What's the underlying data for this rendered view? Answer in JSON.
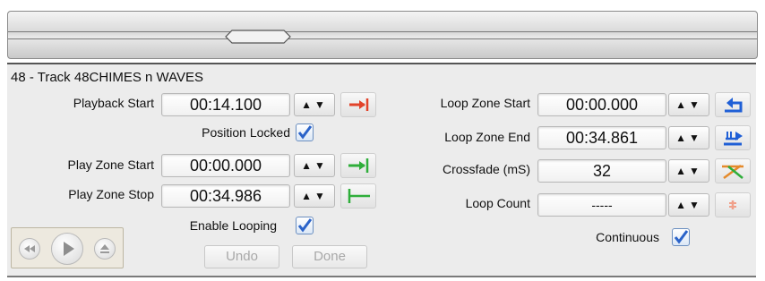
{
  "track_title": "48 - Track 48CHIMES n WAVES",
  "left": {
    "playback_start": {
      "label": "Playback Start",
      "value": "00:14.100"
    },
    "position_locked": {
      "label": "Position Locked",
      "checked": true
    },
    "play_zone_start": {
      "label": "Play Zone Start",
      "value": "00:00.000"
    },
    "play_zone_stop": {
      "label": "Play Zone Stop",
      "value": "00:34.986"
    },
    "enable_looping": {
      "label": "Enable Looping",
      "checked": true
    }
  },
  "right": {
    "loop_zone_start": {
      "label": "Loop Zone Start",
      "value": "00:00.000"
    },
    "loop_zone_end": {
      "label": "Loop Zone End",
      "value": "00:34.861"
    },
    "crossfade": {
      "label": "Crossfade (mS)",
      "value": "32"
    },
    "loop_count": {
      "label": "Loop Count",
      "value": "-----"
    },
    "continuous": {
      "label": "Continuous",
      "checked": true
    }
  },
  "spinner_glyph": "▲▼",
  "buttons": {
    "undo": "Undo",
    "done": "Done"
  },
  "icons": {
    "set_playback_start": "set-playback-start-icon",
    "set_zone_start": "set-zone-start-icon",
    "set_zone_stop": "set-zone-stop-icon",
    "loop_start": "loop-start-icon",
    "loop_end": "loop-end-icon",
    "crossfade": "crossfade-icon",
    "loop_count": "loop-count-icon"
  },
  "colors": {
    "red_icon": "#e2432a",
    "green_icon": "#2fae3a",
    "blue_icon": "#1f5fd6",
    "orange_icon": "#e58a2a",
    "check": "#2a63c9"
  }
}
